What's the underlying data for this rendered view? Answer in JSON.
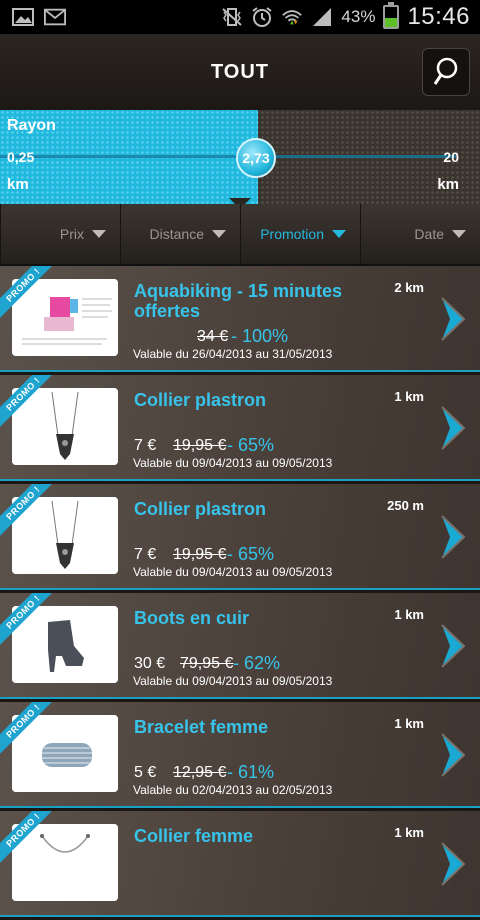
{
  "statusbar": {
    "battery_pct": "43%",
    "battery_level": 0.43,
    "time": "15:46",
    "icons_left": [
      "image-icon",
      "gmail-icon"
    ],
    "icons_right": [
      "vibrate-icon",
      "alarm-icon",
      "wifi-icon",
      "signal-icon",
      "battery-icon"
    ]
  },
  "header": {
    "title": "TOUT"
  },
  "radius": {
    "label": "Rayon",
    "min": "0,25",
    "max": "20",
    "value": "2,73",
    "unit_left": "km",
    "unit_right": "km",
    "fraction": 0.13
  },
  "sort": {
    "items": [
      {
        "label": "Prix",
        "active": false
      },
      {
        "label": "Distance",
        "active": false
      },
      {
        "label": "Promotion",
        "active": true
      },
      {
        "label": "Date",
        "active": false
      }
    ]
  },
  "promo_label": "PROMO !",
  "colors": {
    "accent": "#37c3ea",
    "slider": "#21b8de"
  },
  "products": [
    {
      "title": "Aquabiking - 15 minutes offertes",
      "distance": "2 km",
      "price": "",
      "old_price": "34 €",
      "discount": "- 100%",
      "validity": "Valable du 26/04/2013 au 31/05/2013",
      "image": "aquabike-flyer"
    },
    {
      "title": "Collier plastron",
      "distance": "1 km",
      "price": "7 €",
      "old_price": "19,95 €",
      "discount": "- 65%",
      "validity": "Valable du 09/04/2013 au 09/05/2013",
      "image": "necklace"
    },
    {
      "title": "Collier plastron",
      "distance": "250 m",
      "price": "7 €",
      "old_price": "19,95 €",
      "discount": "- 65%",
      "validity": "Valable du 09/04/2013 au 09/05/2013",
      "image": "necklace"
    },
    {
      "title": "Boots en cuir",
      "distance": "1 km",
      "price": "30 €",
      "old_price": "79,95 €",
      "discount": "- 62%",
      "validity": "Valable du 09/04/2013 au 09/05/2013",
      "image": "boot"
    },
    {
      "title": "Bracelet femme",
      "distance": "1 km",
      "price": "5 €",
      "old_price": "12,95 €",
      "discount": "- 61%",
      "validity": "Valable du 02/04/2013 au 02/05/2013",
      "image": "bracelet"
    },
    {
      "title": "Collier femme",
      "distance": "1 km",
      "price": "",
      "old_price": "",
      "discount": "",
      "validity": "",
      "image": "necklace-round"
    }
  ]
}
